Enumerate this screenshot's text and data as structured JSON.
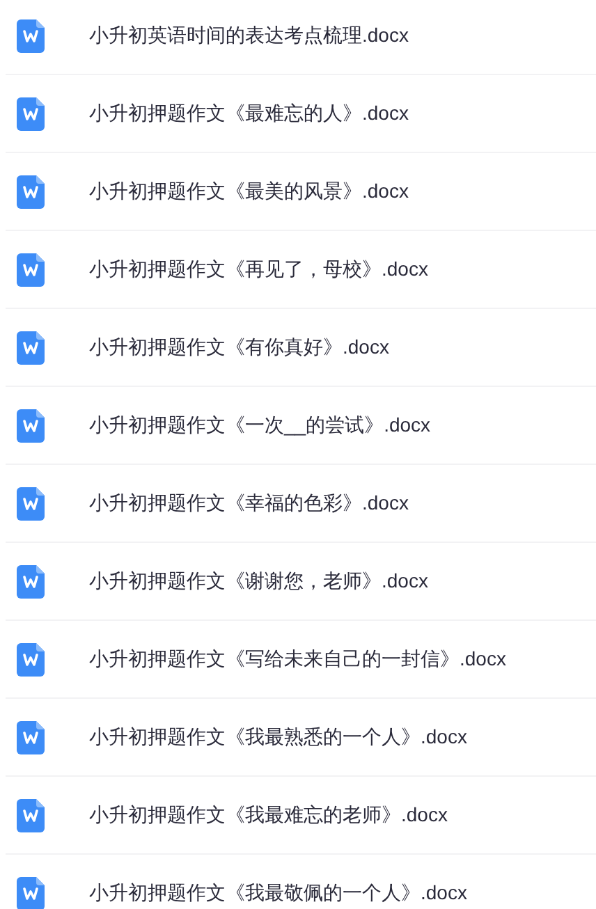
{
  "files": [
    {
      "name": "小升初英语时间的表达考点梳理.docx"
    },
    {
      "name": "小升初押题作文《最难忘的人》.docx"
    },
    {
      "name": "小升初押题作文《最美的风景》.docx"
    },
    {
      "name": "小升初押题作文《再见了，母校》.docx"
    },
    {
      "name": "小升初押题作文《有你真好》.docx"
    },
    {
      "name": "小升初押题作文《一次__的尝试》.docx"
    },
    {
      "name": "小升初押题作文《幸福的色彩》.docx"
    },
    {
      "name": "小升初押题作文《谢谢您，老师》.docx"
    },
    {
      "name": "小升初押题作文《写给未来自己的一封信》.docx"
    },
    {
      "name": "小升初押题作文《我最熟悉的一个人》.docx"
    },
    {
      "name": "小升初押题作文《我最难忘的老师》.docx"
    },
    {
      "name": "小升初押题作文《我最敬佩的一个人》.docx"
    }
  ]
}
